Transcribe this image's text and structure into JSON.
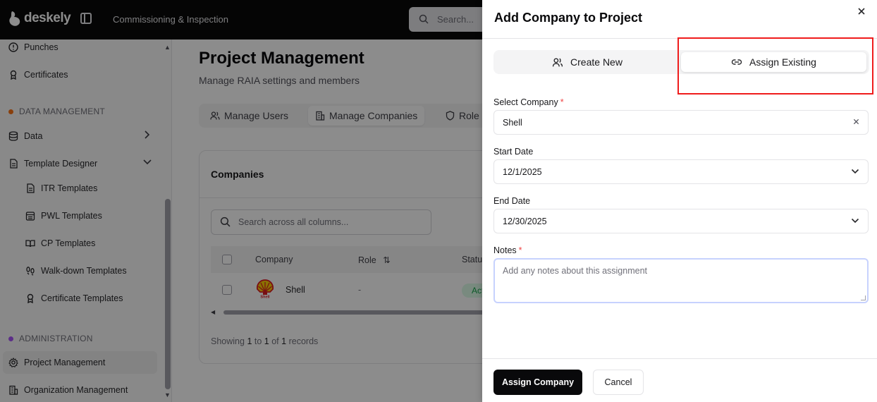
{
  "topbar": {
    "logo_text": "deskely",
    "app_title": "Commissioning & Inspection",
    "search_placeholder": "Search..."
  },
  "sidebar": {
    "items_top": [
      {
        "label": "Punches",
        "icon": "clock-alert-icon"
      },
      {
        "label": "Certificates",
        "icon": "award-icon"
      }
    ],
    "section_data": {
      "label": "DATA MANAGEMENT",
      "color": "#f97316"
    },
    "data_label": "Data",
    "template_designer_label": "Template Designer",
    "templates": [
      {
        "label": "ITR Templates",
        "icon": "file-text-icon"
      },
      {
        "label": "PWL Templates",
        "icon": "calendar-list-icon"
      },
      {
        "label": "CP Templates",
        "icon": "book-open-icon"
      },
      {
        "label": "Walk-down Templates",
        "icon": "footprints-icon"
      },
      {
        "label": "Certificate Templates",
        "icon": "award-icon"
      }
    ],
    "section_admin": {
      "label": "ADMINISTRATION",
      "color": "#a855f7"
    },
    "project_management_label": "Project Management",
    "organization_management_label": "Organization Management"
  },
  "main": {
    "title": "Project Management",
    "subtitle": "Manage RAIA settings and members",
    "tabs": [
      {
        "label": "Manage Users",
        "icon": "users-icon"
      },
      {
        "label": "Manage Companies",
        "icon": "building-icon"
      },
      {
        "label": "Role I",
        "icon": "shield-icon"
      }
    ],
    "card_title": "Companies",
    "table_search_placeholder": "Search across all columns...",
    "columns": [
      "Company",
      "Role",
      "Statu"
    ],
    "rows": [
      {
        "company": "Shell",
        "role": "-",
        "status": "Act"
      }
    ],
    "footer": {
      "prefix": "Showing",
      "from": "1",
      "to_word": "to",
      "to": "1",
      "of_word": "of",
      "total": "1",
      "suffix": "records"
    }
  },
  "drawer": {
    "title": "Add Company to Project",
    "seg_create": "Create New",
    "seg_assign": "Assign Existing",
    "select_company_label": "Select Company",
    "select_company_value": "Shell",
    "start_date_label": "Start Date",
    "start_date_value": "12/1/2025",
    "end_date_label": "End Date",
    "end_date_value": "12/30/2025",
    "notes_label": "Notes",
    "notes_placeholder": "Add any notes about this assignment",
    "required_mark": "*",
    "assign_button": "Assign Company",
    "cancel_button": "Cancel"
  },
  "colors": {
    "highlight_box": "#ef1c1c",
    "primary": "#09090b",
    "status_active": "#16a34a"
  }
}
